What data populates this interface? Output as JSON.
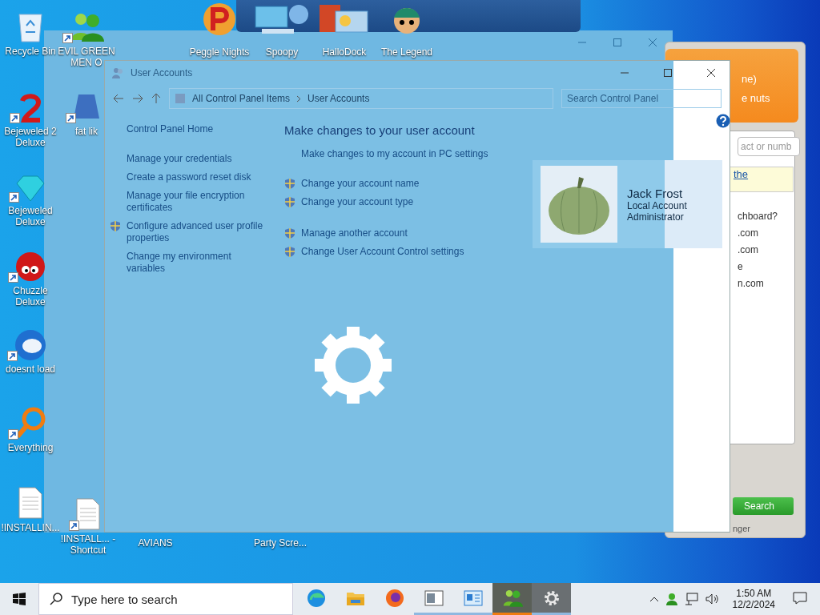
{
  "desktop_icons": [
    {
      "label": "Recycle Bin",
      "kind": "recycle-bin",
      "shortcut": false
    },
    {
      "label": "Bejeweled 2 Deluxe",
      "kind": "number-two",
      "shortcut": true
    },
    {
      "label": "Bejeweled Deluxe",
      "kind": "gem",
      "shortcut": true
    },
    {
      "label": "Chuzzle Deluxe",
      "kind": "red-ball",
      "shortcut": true
    },
    {
      "label": "doesnt load",
      "kind": "mail",
      "shortcut": true
    },
    {
      "label": "Everything",
      "kind": "magnifier",
      "shortcut": true
    },
    {
      "label": "!INSTALLIN...",
      "kind": "document",
      "shortcut": false
    },
    {
      "label": "EVIL GREEN MEN O",
      "kind": "people",
      "shortcut": true
    },
    {
      "label": "fat lik",
      "kind": "generic",
      "shortcut": true
    },
    {
      "label": "!INSTALL... - Shortcut",
      "kind": "document",
      "shortcut": true
    },
    {
      "label": "AVIANS",
      "kind": "none"
    },
    {
      "label": "Party Scre...",
      "kind": "none"
    }
  ],
  "dock": {
    "items": [
      {
        "label": "Peggle Nights",
        "kind": "peggle"
      },
      {
        "label": "Spoopy",
        "kind": "computer"
      },
      {
        "label": "HalloDock",
        "kind": "dock-app"
      },
      {
        "label": "The Legend",
        "kind": "character"
      }
    ]
  },
  "window": {
    "title": "User Accounts",
    "breadcrumb": [
      "All Control Panel Items",
      "User Accounts"
    ],
    "search": {
      "placeholder": "Search Control Panel"
    },
    "sidebar": [
      {
        "label": "Control Panel Home",
        "shield": false
      },
      {
        "label": "Manage your credentials",
        "shield": false
      },
      {
        "label": "Create a password reset disk",
        "shield": false
      },
      {
        "label": "Manage your file encryption certificates",
        "shield": false
      },
      {
        "label": "Configure advanced user profile properties",
        "shield": true
      },
      {
        "label": "Change my environment variables",
        "shield": false
      }
    ],
    "heading": "Make changes to your user account",
    "task_groups": [
      [
        {
          "label": "Make changes to my account in PC settings",
          "shield": false
        },
        {
          "label": "Change your account name",
          "shield": true
        },
        {
          "label": "Change your account type",
          "shield": true
        }
      ],
      [
        {
          "label": "Manage another account",
          "shield": true
        },
        {
          "label": "Change User Account Control settings",
          "shield": true
        }
      ]
    ],
    "user": {
      "name": "Jack Frost",
      "details": [
        "Local Account",
        "Administrator"
      ]
    },
    "loading": true
  },
  "messenger": {
    "header": [
      "ne)",
      "e nuts"
    ],
    "search": {
      "placeholder": "act or numb"
    },
    "notice_link": "the",
    "list": [
      "chboard?",
      ".com",
      ".com",
      "e",
      "n.com"
    ],
    "search_button": "Search",
    "status": "nger"
  },
  "taskbar": {
    "search": {
      "placeholder": "Type here to search"
    },
    "apps": [
      {
        "kind": "browser-e",
        "running": false,
        "selected": false
      },
      {
        "kind": "folder",
        "running": false,
        "selected": false
      },
      {
        "kind": "fox",
        "running": false,
        "selected": false
      },
      {
        "kind": "window-app",
        "running": true,
        "selected": false
      },
      {
        "kind": "card-app",
        "running": true,
        "selected": false
      },
      {
        "kind": "people",
        "running": true,
        "selected": true
      },
      {
        "kind": "gear",
        "running": true,
        "selected": false
      }
    ],
    "time": "1:50 AM",
    "date": "12/2/2024"
  }
}
